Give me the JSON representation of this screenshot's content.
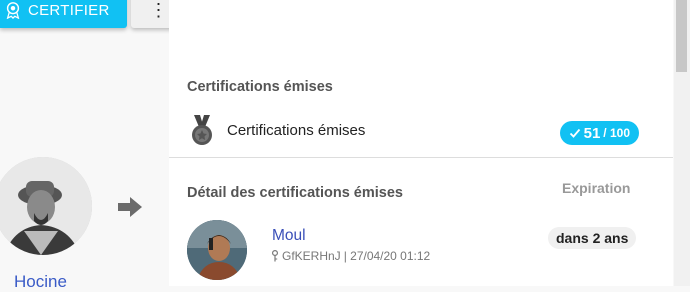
{
  "toolbar": {
    "certify_label": "CERTIFIER",
    "more_label": "⋮"
  },
  "profile": {
    "name": "Hocine"
  },
  "issued": {
    "section_title": "Certifications émises",
    "row_label": "Certifications émises",
    "count": "51",
    "max": "/ 100"
  },
  "detail": {
    "section_title": "Détail des certifications émises",
    "expiration_header": "Expiration",
    "items": [
      {
        "name": "Moul",
        "key": "GfKERHnJ",
        "date": "| 27/04/20 01:12",
        "expiration": "dans 2 ans"
      }
    ]
  },
  "colors": {
    "accent": "#11c1f3",
    "link": "#3a5bc7"
  }
}
